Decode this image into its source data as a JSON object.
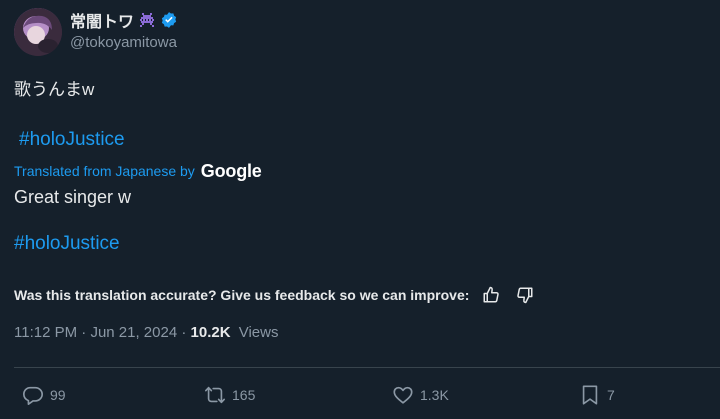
{
  "user": {
    "display_name": "常闇トワ",
    "handle": "@tokoyamitowa"
  },
  "tweet": {
    "text": "歌うんまw",
    "hashtag": "#holoJustice"
  },
  "translation": {
    "label": "Translated from Japanese by",
    "provider": "Google",
    "text": "Great singer w",
    "hashtag": "#holoJustice"
  },
  "feedback": {
    "prompt": "Was this translation accurate? Give us feedback so we can improve:"
  },
  "meta": {
    "time": "11:12 PM",
    "date": "Jun 21, 2024",
    "views_count": "10.2K",
    "views_label": "Views"
  },
  "actions": {
    "replies": "99",
    "reposts": "165",
    "likes": "1.3K",
    "bookmarks": "7"
  },
  "icons": [
    "avatar",
    "space-invader-icon",
    "verified-badge-icon",
    "thumbs-up-icon",
    "thumbs-down-icon",
    "reply-icon",
    "repost-icon",
    "like-icon",
    "bookmark-icon"
  ],
  "colors": {
    "background": "#15202b",
    "text": "#e7e9ea",
    "secondary": "#8b98a5",
    "link": "#1d9bf0",
    "verified": "#1d9bf0",
    "divider": "#38444d"
  }
}
